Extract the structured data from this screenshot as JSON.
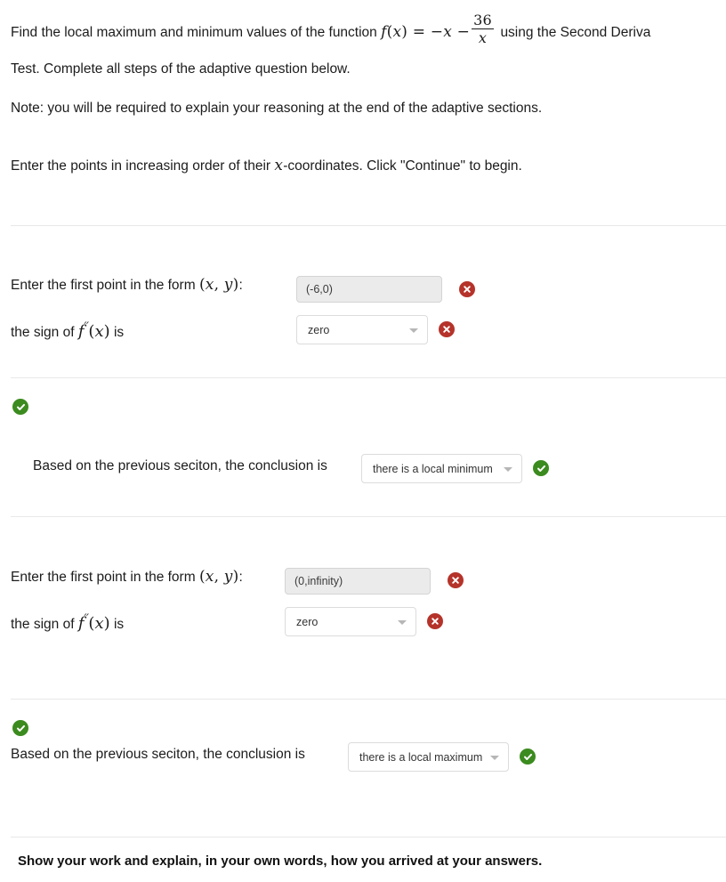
{
  "intro": {
    "line1_a": "Find the local maximum and minimum values of the function",
    "formula": {
      "f": "f",
      "open": "(",
      "var": "x",
      "close": ")",
      "equals": "=",
      "term1": "−x",
      "minus": "−",
      "numerator": "36",
      "denominator": "x"
    },
    "line1_b": "using the Second Deriva",
    "line2": "Test. Complete all steps of the adaptive question below.",
    "note": "Note: you will be required to explain your reasoning at the end of the adaptive sections.",
    "order_a": "Enter the points in increasing order of their",
    "order_var": "x",
    "order_b": "-coordinates. Click \"Continue\" to begin."
  },
  "section1": {
    "point_label": "Enter the first point in the form",
    "point_math_open": "(",
    "point_math_x": "x",
    "point_math_comma": ",",
    "point_math_y": "y",
    "point_math_close": ")",
    "point_label_colon": ":",
    "point_value": "(-6,0)",
    "point_status": "error",
    "sign_label_a": "the sign of",
    "sign_label_f": "f",
    "sign_label_primes": "′′",
    "sign_label_open": "(",
    "sign_label_x": "x",
    "sign_label_close": ")",
    "sign_label_b": "is",
    "sign_value": "zero",
    "sign_status": "error"
  },
  "section2": {
    "flag_status": "ok",
    "conclusion_label": "Based on the previous seciton, the conclusion is",
    "conclusion_value": "there is a local minimum",
    "conclusion_status": "ok"
  },
  "section3": {
    "point_label": "Enter the first point in the form",
    "point_value": "(0,infinity)",
    "point_status": "error",
    "sign_label_a": "the sign of",
    "sign_label_b": "is",
    "sign_value": "zero",
    "sign_status": "error"
  },
  "section4": {
    "flag_status": "ok",
    "conclusion_label": "Based on the previous seciton, the conclusion is",
    "conclusion_value": "there is a local maximum",
    "conclusion_status": "ok"
  },
  "footer": {
    "text": "Show your work and explain, in your own words, how you arrived at your answers."
  },
  "colors": {
    "error": "#b5332a",
    "success": "#3b8b1f",
    "divider": "#e8e8e8",
    "input_bg": "#ebebeb",
    "select_border": "#dcdcdc"
  }
}
